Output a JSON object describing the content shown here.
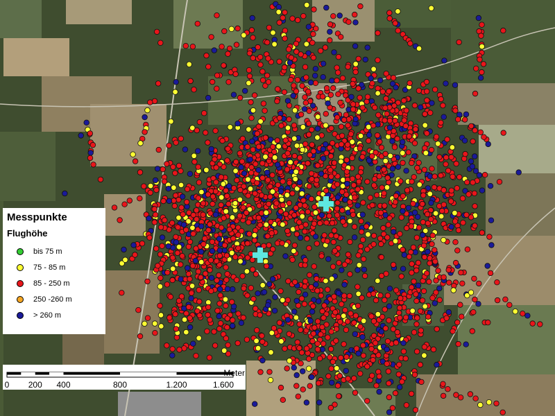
{
  "legend": {
    "title": "Messpunkte",
    "subtitle": "Flughöhe",
    "items": [
      {
        "label": "bis 75 m",
        "color": "#33cc33"
      },
      {
        "label": "75 - 85 m",
        "color": "#ffff33"
      },
      {
        "label": "85 - 250 m",
        "color": "#e8161b"
      },
      {
        "label": "250  -260 m",
        "color": "#f5a623"
      },
      {
        "label": "> 260 m",
        "color": "#1a1a99"
      }
    ]
  },
  "scalebar": {
    "unit": "Meter",
    "ticks": [
      {
        "label": "0",
        "value": 0
      },
      {
        "label": "200",
        "value": 200
      },
      {
        "label": "400",
        "value": 400
      },
      {
        "label": "800",
        "value": 800
      },
      {
        "label": "1.200",
        "value": 1200
      },
      {
        "label": "1.600",
        "value": 1600
      }
    ]
  },
  "markers": {
    "color": "#5ee8e0",
    "count": 2
  }
}
